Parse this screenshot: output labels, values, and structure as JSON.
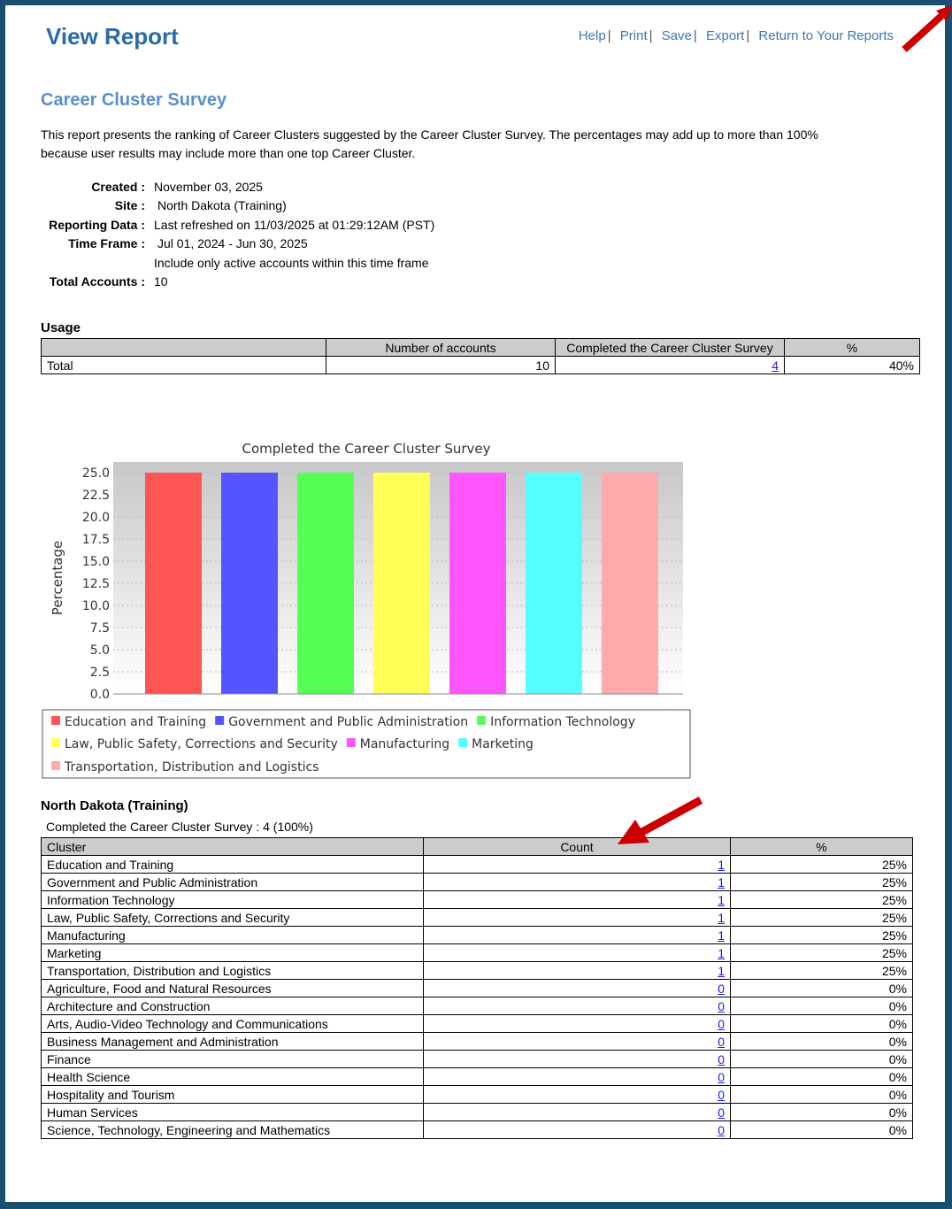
{
  "header": {
    "title": "View Report",
    "links": [
      "Help",
      "Print",
      "Save",
      "Export",
      "Return to Your Reports"
    ]
  },
  "report": {
    "title": "Career Cluster Survey",
    "description": "This report presents the ranking of Career Clusters suggested by the Career Cluster Survey. The percentages may add up to more than 100% because user results may include more than one top Career Cluster.",
    "meta": [
      {
        "label": "Created :",
        "value": "November 03, 2025"
      },
      {
        "label": "Site :",
        "value": "North Dakota (Training)"
      },
      {
        "label": "Reporting Data :",
        "value": "Last refreshed on 11/03/2025 at 01:29:12AM (PST)"
      },
      {
        "label": "Time Frame :",
        "value": "Jul 01, 2024 - Jun 30, 2025"
      },
      {
        "label": "",
        "value": "Include only active accounts within this time frame"
      },
      {
        "label": "Total Accounts :",
        "value": "10"
      }
    ]
  },
  "usage": {
    "heading": "Usage",
    "columns": [
      "",
      "Number of accounts",
      "Completed the Career Cluster Survey",
      "%"
    ],
    "row": {
      "label": "Total",
      "accounts": "10",
      "completed": "4",
      "pct": "40%"
    }
  },
  "chart_data": {
    "type": "bar",
    "title": "Completed the Career Cluster Survey",
    "ylabel": "Percentage",
    "xlabel": "",
    "ylim": [
      0,
      25
    ],
    "yticks": [
      "0.0",
      "2.5",
      "5.0",
      "7.5",
      "10.0",
      "12.5",
      "15.0",
      "17.5",
      "20.0",
      "22.5",
      "25.0"
    ],
    "grid": true,
    "legend_position": "bottom",
    "series": [
      {
        "name": "Education and Training",
        "value": 25,
        "color": "#ff5555"
      },
      {
        "name": "Government and Public Administration",
        "value": 25,
        "color": "#5555ff"
      },
      {
        "name": "Information Technology",
        "value": 25,
        "color": "#55ff55"
      },
      {
        "name": "Law, Public Safety, Corrections and Security",
        "value": 25,
        "color": "#ffff55"
      },
      {
        "name": "Manufacturing",
        "value": 25,
        "color": "#ff55ff"
      },
      {
        "name": "Marketing",
        "value": 25,
        "color": "#55ffff"
      },
      {
        "name": "Transportation, Distribution and Logistics",
        "value": 25,
        "color": "#ffaaaa"
      }
    ]
  },
  "site": {
    "heading": "North Dakota (Training)",
    "subheading": "Completed the Career Cluster Survey : 4 (100%)",
    "columns": [
      "Cluster",
      "Count",
      "%"
    ],
    "rows": [
      {
        "cluster": "Education and Training",
        "count": "1",
        "pct": "25%"
      },
      {
        "cluster": "Government and Public Administration",
        "count": "1",
        "pct": "25%"
      },
      {
        "cluster": "Information Technology",
        "count": "1",
        "pct": "25%"
      },
      {
        "cluster": "Law, Public Safety, Corrections and Security",
        "count": "1",
        "pct": "25%"
      },
      {
        "cluster": "Manufacturing",
        "count": "1",
        "pct": "25%"
      },
      {
        "cluster": "Marketing",
        "count": "1",
        "pct": "25%"
      },
      {
        "cluster": "Transportation, Distribution and Logistics",
        "count": "1",
        "pct": "25%"
      },
      {
        "cluster": "Agriculture, Food and Natural Resources",
        "count": "0",
        "pct": "0%"
      },
      {
        "cluster": "Architecture and Construction",
        "count": "0",
        "pct": "0%"
      },
      {
        "cluster": "Arts, Audio-Video Technology and Communications",
        "count": "0",
        "pct": "0%"
      },
      {
        "cluster": "Business Management and Administration",
        "count": "0",
        "pct": "0%"
      },
      {
        "cluster": "Finance",
        "count": "0",
        "pct": "0%"
      },
      {
        "cluster": "Health Science",
        "count": "0",
        "pct": "0%"
      },
      {
        "cluster": "Hospitality and Tourism",
        "count": "0",
        "pct": "0%"
      },
      {
        "cluster": "Human Services",
        "count": "0",
        "pct": "0%"
      },
      {
        "cluster": "Science, Technology, Engineering and Mathematics",
        "count": "0",
        "pct": "0%"
      }
    ]
  },
  "colors": {
    "frame": "#1b4f6e",
    "title": "#2a6aa8",
    "annotation_arrow": "#cc0000"
  }
}
